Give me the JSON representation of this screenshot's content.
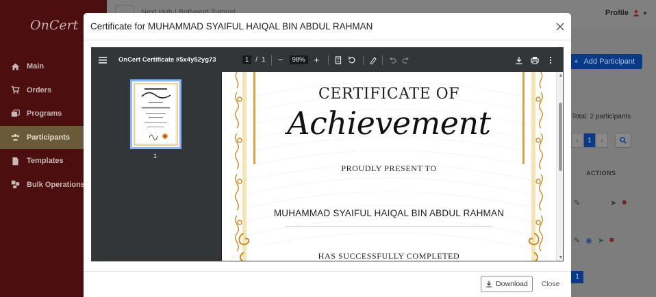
{
  "app": {
    "brand": "OnCert",
    "breadcrumb": "Next Hub | Bollywud Tutorial",
    "profile_label": "Profile"
  },
  "sidebar": {
    "items": [
      {
        "label": "Main",
        "icon": "home-icon",
        "active": false
      },
      {
        "label": "Orders",
        "icon": "cart-icon",
        "active": false
      },
      {
        "label": "Programs",
        "icon": "programs-icon",
        "active": false
      },
      {
        "label": "Participants",
        "icon": "users-icon",
        "active": true
      },
      {
        "label": "Templates",
        "icon": "file-icon",
        "active": false
      },
      {
        "label": "Bulk Operations",
        "icon": "bulk-icon",
        "active": false
      }
    ]
  },
  "background_page": {
    "add_participant_label": "Add Participant",
    "total_label": "Total: 2 participants",
    "current_page": "1",
    "actions_header": "ACTIONS"
  },
  "modal": {
    "title": "Certificate for MUHAMMAD SYAIFUL HAIQAL BIN ABDUL RAHMAN",
    "download_label": "Download",
    "close_label": "Close"
  },
  "pdf_viewer": {
    "doc_name": "OnCert Certificate #5x4y52yg73",
    "current_page": "1",
    "page_separator": "/",
    "total_pages": "1",
    "zoom": "98%",
    "thumbnail_label": "1"
  },
  "certificate": {
    "heading": "CERTIFICATE OF",
    "script_title": "Achievement",
    "present_line": "PROUDLY PRESENT TO",
    "recipient_name": "MUHAMMAD SYAIFUL HAIQAL BIN ABDUL RAHMAN",
    "completed_line": "HAS SUCCESSFULLY COMPLETED"
  },
  "colors": {
    "sidebar_bg": "#4c0e0e",
    "accent_gold": "#d9a441",
    "viewer_toolbar": "#323639",
    "primary_blue": "#0d6efd"
  }
}
